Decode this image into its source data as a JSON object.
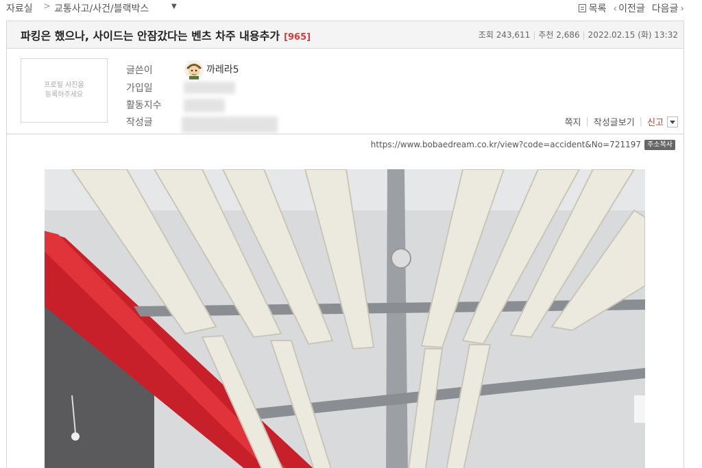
{
  "breadcrumb": {
    "root": "자료실",
    "separator": ">",
    "category": "교통사고/사건/블랙박스"
  },
  "nav": {
    "list_label": "목록",
    "prev_label": "이전글",
    "next_label": "다음글"
  },
  "post": {
    "title": "파킹은 했으나, 사이드는 안잠갔다는 벤츠 차주 내용추가",
    "comment_count": "[965]",
    "views": "조회 243,611",
    "recommend": "추천 2,686",
    "datetime": "2022.02.15 (화) 13:32",
    "accent_color": "#d23c3c"
  },
  "profile": {
    "photo_placeholder": "프로필 사진을\n등록하주세요",
    "labels": {
      "author": "글쓴이",
      "joined": "가입일",
      "activity": "활동지수",
      "posts": "작성글"
    },
    "nickname": "까레라5",
    "actions": {
      "message": "쪽지",
      "view_posts": "작성글보기",
      "report": "신고"
    }
  },
  "url": {
    "address": "https://www.bobaedream.co.kr/view?code=accident&No=721197",
    "copy_label": "주소복사"
  },
  "icons": {
    "list": "list-icon",
    "prev": "chevron-left-icon",
    "next": "chevron-right-icon",
    "dropdown": "chevron-down-icon"
  }
}
